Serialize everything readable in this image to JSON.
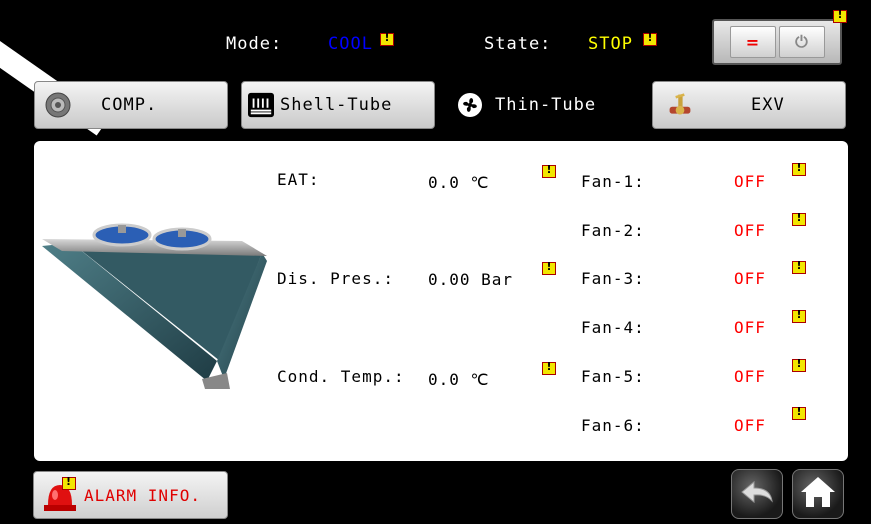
{
  "header": {
    "mode_label": "Mode:",
    "mode_value": "COOL",
    "state_label": "State:",
    "state_value": "STOP",
    "power_on_symbol": "=",
    "power_off_symbol": "⏻"
  },
  "tabs": [
    {
      "label": "COMP.",
      "icon": "gear-icon"
    },
    {
      "label": "Shell-Tube",
      "icon": "heat-exchanger-icon"
    },
    {
      "label": "Thin-Tube",
      "icon": "fan-icon",
      "active": true
    },
    {
      "label": "EXV",
      "icon": "valve-icon"
    }
  ],
  "readings": {
    "eat": {
      "label": "EAT:",
      "value": "0.0 ℃"
    },
    "dis_pres": {
      "label": "Dis. Pres.:",
      "value": "0.00 Bar"
    },
    "cond_temp": {
      "label": "Cond. Temp.:",
      "value": "0.0 ℃"
    }
  },
  "fans": [
    {
      "label": "Fan-1:",
      "status": "OFF"
    },
    {
      "label": "Fan-2:",
      "status": "OFF"
    },
    {
      "label": "Fan-3:",
      "status": "OFF"
    },
    {
      "label": "Fan-4:",
      "status": "OFF"
    },
    {
      "label": "Fan-5:",
      "status": "OFF"
    },
    {
      "label": "Fan-6:",
      "status": "OFF"
    }
  ],
  "footer": {
    "alarm_label": "ALARM INFO."
  },
  "colors": {
    "mode_value": "#0000ff",
    "state_value": "#ffff00",
    "off_status": "#ff0000",
    "alarm_text": "#e00000"
  }
}
